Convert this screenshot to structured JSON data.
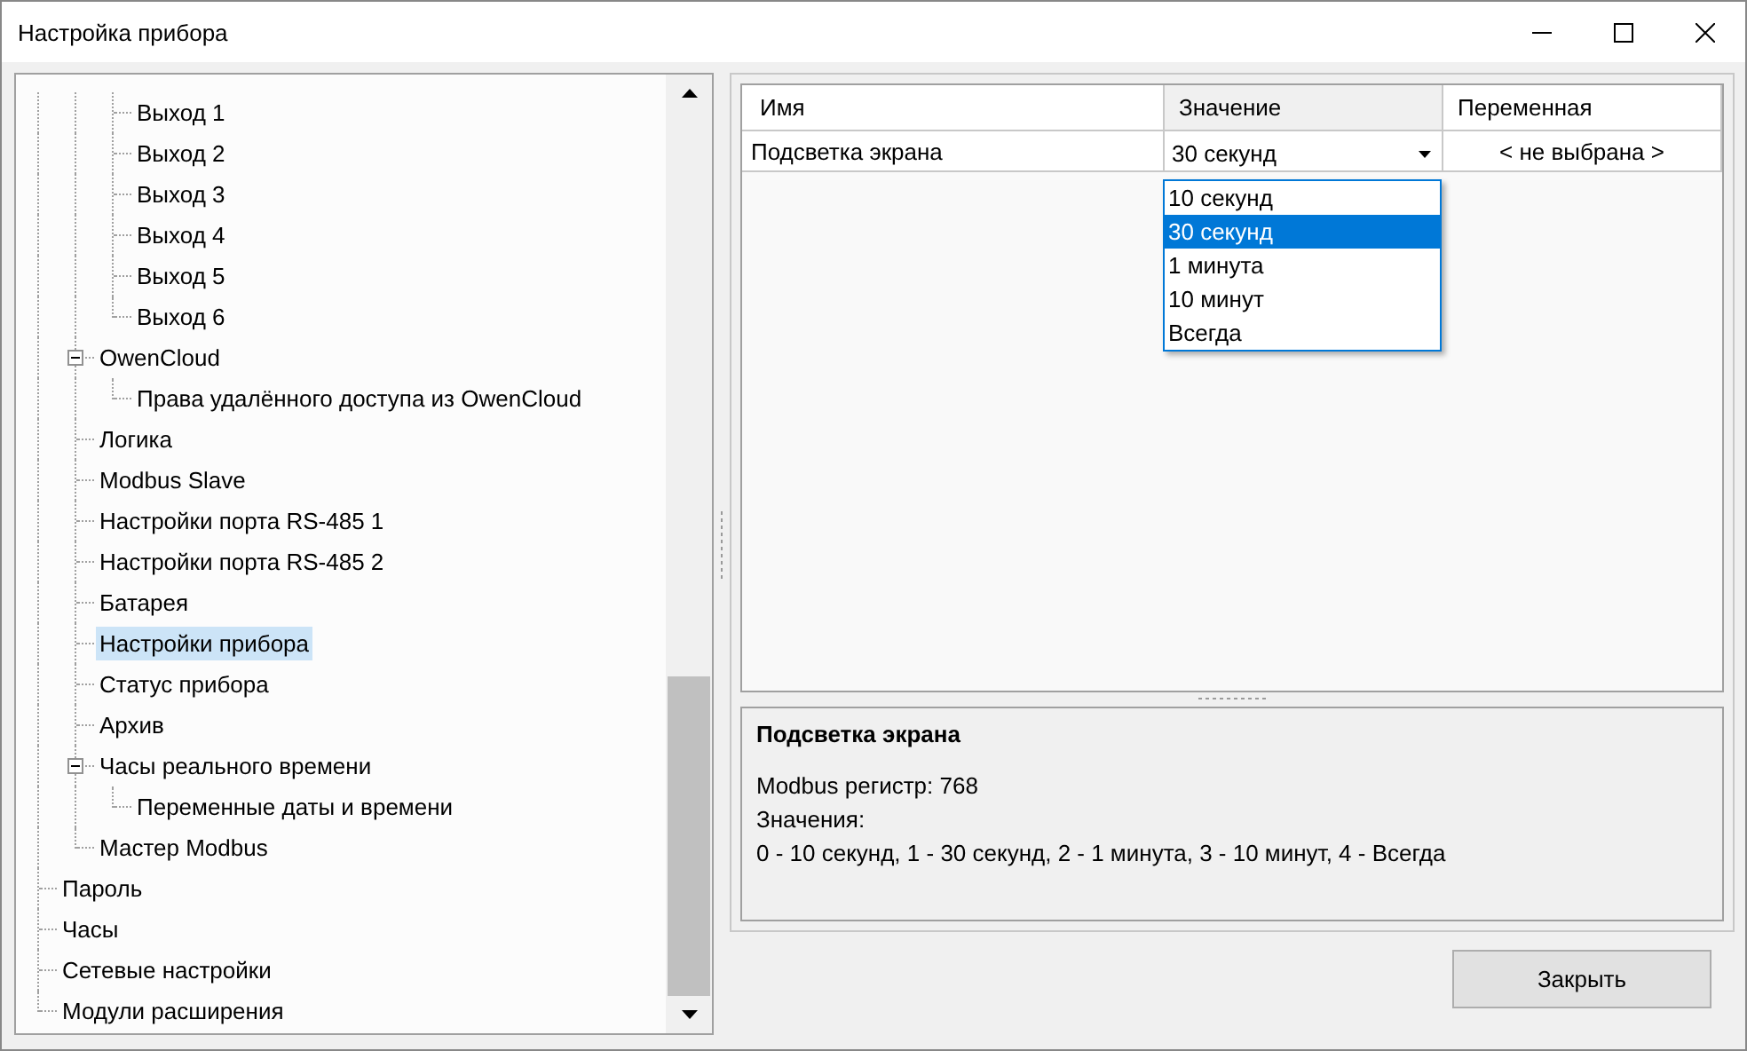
{
  "window": {
    "title": "Настройка прибора"
  },
  "tree": [
    {
      "children": [
        {
          "children": [
            {
              "label": "Выход 1",
              "selected": false
            },
            {
              "label": "Выход 2",
              "selected": false
            },
            {
              "label": "Выход 3",
              "selected": false
            },
            {
              "label": "Выход 4",
              "selected": false
            },
            {
              "label": "Выход 5",
              "selected": false
            },
            {
              "label": "Выход 6",
              "selected": false
            }
          ]
        },
        {
          "label": "OwenCloud",
          "selected": false,
          "expanded": true,
          "children": [
            {
              "label": "Права удалённого доступа из OwenCloud",
              "selected": false
            }
          ]
        },
        {
          "label": "Логика",
          "selected": false
        },
        {
          "label": "Modbus Slave",
          "selected": false
        },
        {
          "label": "Настройки порта RS-485 1",
          "selected": false
        },
        {
          "label": "Настройки порта RS-485 2",
          "selected": false
        },
        {
          "label": "Батарея",
          "selected": false
        },
        {
          "label": "Настройки прибора",
          "selected": true
        },
        {
          "label": "Статус прибора",
          "selected": false
        },
        {
          "label": "Архив",
          "selected": false
        },
        {
          "label": "Часы реального времени",
          "selected": false,
          "expanded": true,
          "children": [
            {
              "label": "Переменные даты и времени",
              "selected": false
            }
          ]
        },
        {
          "label": "Мастер Modbus",
          "selected": false
        }
      ]
    },
    {
      "label": "Пароль",
      "selected": false
    },
    {
      "label": "Часы",
      "selected": false
    },
    {
      "label": "Сетевые настройки",
      "selected": false
    },
    {
      "label": "Модули расширения",
      "selected": false
    }
  ],
  "table": {
    "columns": [
      "Имя",
      "Значение",
      "Переменная"
    ],
    "rows": [
      {
        "name": "Подсветка экрана",
        "value": "30 секунд",
        "variable": "< не выбрана >"
      }
    ]
  },
  "dropdown": {
    "options": [
      {
        "label": "10 секунд",
        "selected": false
      },
      {
        "label": "30 секунд",
        "selected": true
      },
      {
        "label": "1 минута",
        "selected": false
      },
      {
        "label": "10 минут",
        "selected": false
      },
      {
        "label": "Всегда",
        "selected": false
      }
    ]
  },
  "description": {
    "title": "Подсветка экрана",
    "lines": [
      "Modbus регистр: 768",
      "Значения:",
      "0 - 10 секунд, 1 - 30 секунд, 2 - 1 минута, 3 - 10 минут, 4 - Всегда"
    ]
  },
  "buttons": [
    "Закрыть"
  ]
}
